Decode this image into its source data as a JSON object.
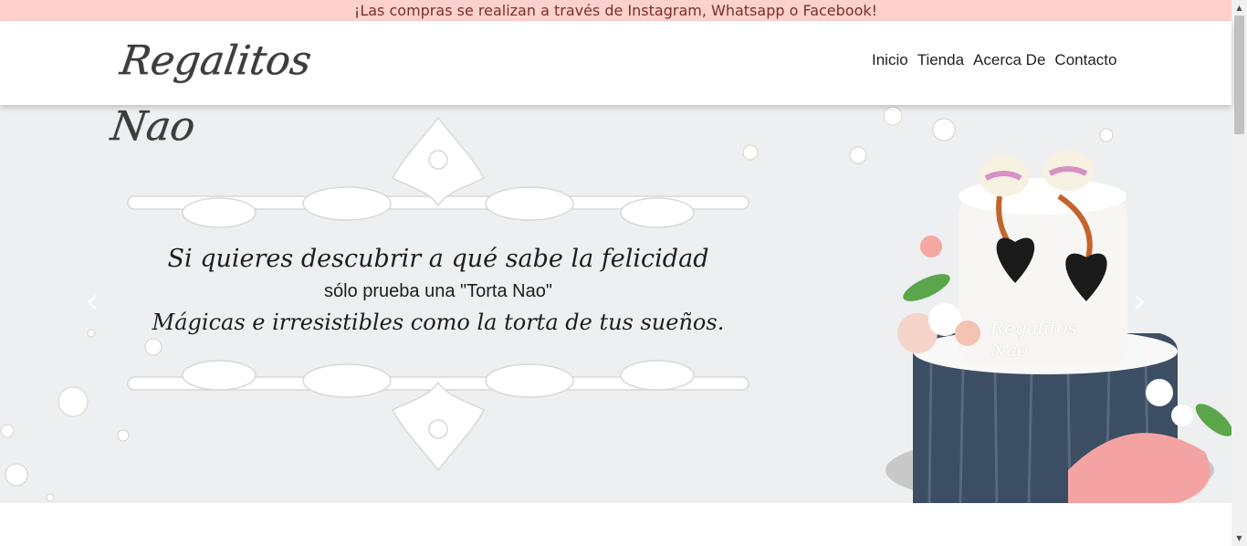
{
  "announcement": "¡Las compras se realizan a través de Instagram, Whatsapp o Facebook!",
  "logo_text": "Regalitos Nao",
  "nav": {
    "items": [
      "Inicio",
      "Tienda",
      "Acerca De",
      "Contacto"
    ]
  },
  "hero": {
    "line1": "Si quieres descubrir a qué sabe la felicidad",
    "line2": "sólo prueba una \"Torta Nao\"",
    "line3": "Mágicas e irresistibles como la torta de tus sueños.",
    "cake_brand": "Regalitos Nao",
    "prev_icon": "chevron-left-icon",
    "next_icon": "chevron-right-icon"
  },
  "colors": {
    "announcement_bg": "#ffd1cc",
    "hero_bg": "#eeeff1"
  }
}
